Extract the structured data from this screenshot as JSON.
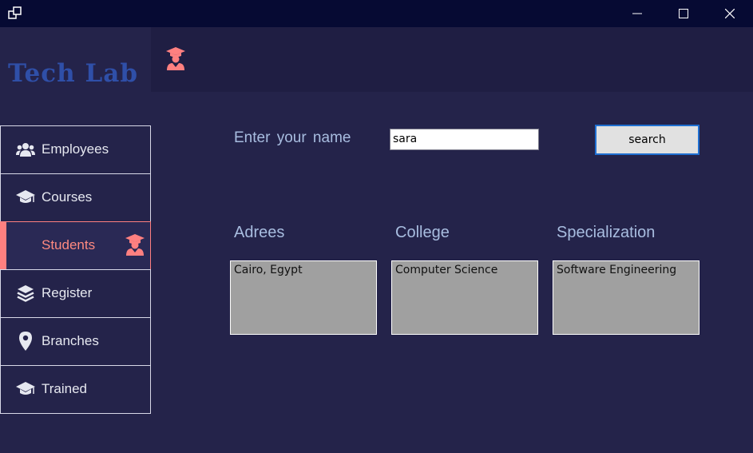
{
  "titlebar": {
    "icons": {
      "app": "window-app-icon",
      "minimize": "minimize-icon",
      "maximize": "maximize-icon",
      "close": "close-icon"
    }
  },
  "sidebar": {
    "logo": "Tech Lab",
    "items": [
      {
        "label": "Employees",
        "icon": "users-icon"
      },
      {
        "label": "Courses",
        "icon": "graduation-cap-icon"
      },
      {
        "label": "Students",
        "icon": "student-icon",
        "active": true
      },
      {
        "label": "Register",
        "icon": "layers-icon"
      },
      {
        "label": "Branches",
        "icon": "map-pin-icon"
      },
      {
        "label": "Trained",
        "icon": "graduation-cap-icon"
      }
    ]
  },
  "header": {
    "icon": "student-icon"
  },
  "search": {
    "prompt": "Enter your name",
    "value": "sara",
    "button": "search"
  },
  "results": {
    "columns": [
      {
        "label": "Adrees",
        "value": "Cairo, Egypt"
      },
      {
        "label": "College",
        "value": "Computer Science"
      },
      {
        "label": "Specialization",
        "value": "Software Engineering"
      }
    ]
  },
  "colors": {
    "titlebar": "#060a33",
    "background": "#24234a",
    "header": "#1f1e43",
    "accent": "#ff8080",
    "logo": "#2f4fa8",
    "label": "#a8bde0"
  }
}
